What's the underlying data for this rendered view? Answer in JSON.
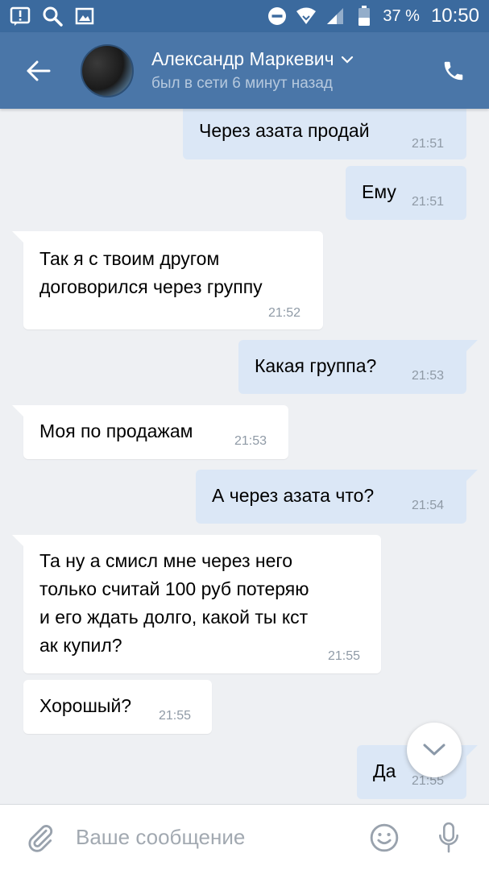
{
  "status_bar": {
    "battery_percent": "37 %",
    "time": "10:50"
  },
  "header": {
    "contact_name": "Александр Маркевич",
    "contact_status": "был в сети 6 минут назад"
  },
  "messages": [
    {
      "direction": "out",
      "text": "Через азата продай",
      "time": "21:51"
    },
    {
      "direction": "out",
      "text": "Ему",
      "time": "21:51"
    },
    {
      "direction": "in",
      "text": "Так я с твоим другом\nдоговорился через группу",
      "time": "21:52"
    },
    {
      "direction": "out",
      "text": "Какая группа?",
      "time": "21:53"
    },
    {
      "direction": "in",
      "text": "Моя по продажам",
      "time": "21:53"
    },
    {
      "direction": "out",
      "text": "А через азата что?",
      "time": "21:54"
    },
    {
      "direction": "in",
      "text": "Та ну а смисл мне через него\nтолько считай 100 руб потеряю\nи его ждать долго, какой ты кст\nак купил?",
      "time": "21:55"
    },
    {
      "direction": "in",
      "text": "Хорошый?",
      "time": "21:55"
    },
    {
      "direction": "out",
      "text": "Да",
      "time": "21:55"
    }
  ],
  "input": {
    "placeholder": "Ваше сообщение"
  },
  "colors": {
    "header": "#4a76a8",
    "status_bar": "#3b6a9e",
    "outgoing_bubble": "#dbe7f6",
    "incoming_bubble": "#ffffff",
    "chat_background": "#eef0f3"
  }
}
